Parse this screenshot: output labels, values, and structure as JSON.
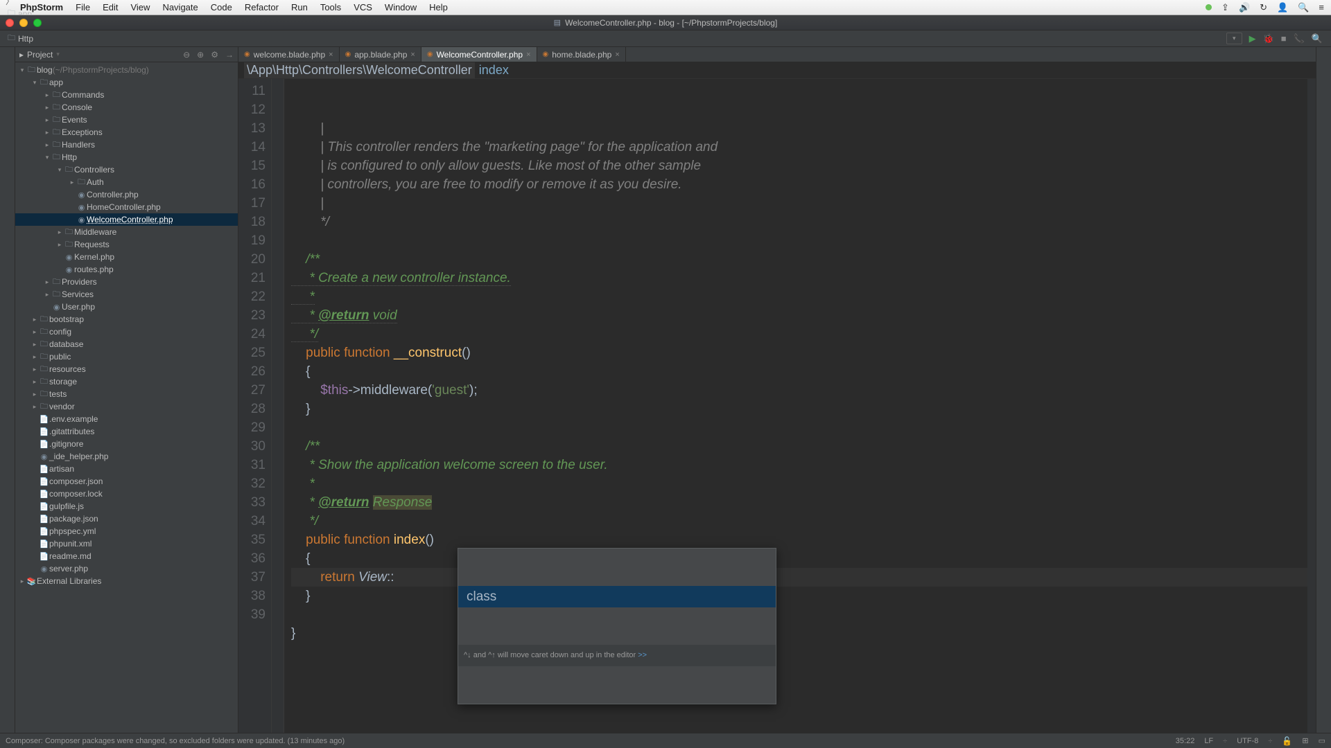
{
  "mac_menu": {
    "apple": "",
    "items": [
      "PhpStorm",
      "File",
      "Edit",
      "View",
      "Navigate",
      "Code",
      "Refactor",
      "Run",
      "Tools",
      "VCS",
      "Window",
      "Help"
    ]
  },
  "titlebar": {
    "title": "WelcomeController.php - blog - [~/PhpstormProjects/blog]"
  },
  "breadcrumbs": [
    "blog",
    "app",
    "Http",
    "Controllers",
    "WelcomeController.php"
  ],
  "tool_header": {
    "label": "Project"
  },
  "tree": [
    {
      "d": 0,
      "a": "v",
      "t": "blog",
      "suffix": " (~/PhpstormProjects/blog)",
      "icon": "dir"
    },
    {
      "d": 1,
      "a": "v",
      "t": "app",
      "icon": "dir"
    },
    {
      "d": 2,
      "a": ">",
      "t": "Commands",
      "icon": "dir"
    },
    {
      "d": 2,
      "a": ">",
      "t": "Console",
      "icon": "dir"
    },
    {
      "d": 2,
      "a": ">",
      "t": "Events",
      "icon": "dir"
    },
    {
      "d": 2,
      "a": ">",
      "t": "Exceptions",
      "icon": "dir"
    },
    {
      "d": 2,
      "a": ">",
      "t": "Handlers",
      "icon": "dir"
    },
    {
      "d": 2,
      "a": "v",
      "t": "Http",
      "icon": "dir"
    },
    {
      "d": 3,
      "a": "v",
      "t": "Controllers",
      "icon": "dir"
    },
    {
      "d": 4,
      "a": ">",
      "t": "Auth",
      "icon": "dir"
    },
    {
      "d": 4,
      "a": "",
      "t": "Controller.php",
      "icon": "php"
    },
    {
      "d": 4,
      "a": "",
      "t": "HomeController.php",
      "icon": "php"
    },
    {
      "d": 4,
      "a": "",
      "t": "WelcomeController.php",
      "icon": "php",
      "selected": true
    },
    {
      "d": 3,
      "a": ">",
      "t": "Middleware",
      "icon": "dir"
    },
    {
      "d": 3,
      "a": ">",
      "t": "Requests",
      "icon": "dir"
    },
    {
      "d": 3,
      "a": "",
      "t": "Kernel.php",
      "icon": "php"
    },
    {
      "d": 3,
      "a": "",
      "t": "routes.php",
      "icon": "php"
    },
    {
      "d": 2,
      "a": ">",
      "t": "Providers",
      "icon": "dir"
    },
    {
      "d": 2,
      "a": ">",
      "t": "Services",
      "icon": "dir"
    },
    {
      "d": 2,
      "a": "",
      "t": "User.php",
      "icon": "php"
    },
    {
      "d": 1,
      "a": ">",
      "t": "bootstrap",
      "icon": "dir"
    },
    {
      "d": 1,
      "a": ">",
      "t": "config",
      "icon": "dir"
    },
    {
      "d": 1,
      "a": ">",
      "t": "database",
      "icon": "dir"
    },
    {
      "d": 1,
      "a": ">",
      "t": "public",
      "icon": "dir"
    },
    {
      "d": 1,
      "a": ">",
      "t": "resources",
      "icon": "dir"
    },
    {
      "d": 1,
      "a": ">",
      "t": "storage",
      "icon": "dir"
    },
    {
      "d": 1,
      "a": ">",
      "t": "tests",
      "icon": "dir"
    },
    {
      "d": 1,
      "a": ">",
      "t": "vendor",
      "icon": "dir"
    },
    {
      "d": 1,
      "a": "",
      "t": ".env.example",
      "icon": "file"
    },
    {
      "d": 1,
      "a": "",
      "t": ".gitattributes",
      "icon": "file"
    },
    {
      "d": 1,
      "a": "",
      "t": ".gitignore",
      "icon": "file"
    },
    {
      "d": 1,
      "a": "",
      "t": "_ide_helper.php",
      "icon": "php"
    },
    {
      "d": 1,
      "a": "",
      "t": "artisan",
      "icon": "file"
    },
    {
      "d": 1,
      "a": "",
      "t": "composer.json",
      "icon": "file"
    },
    {
      "d": 1,
      "a": "",
      "t": "composer.lock",
      "icon": "file"
    },
    {
      "d": 1,
      "a": "",
      "t": "gulpfile.js",
      "icon": "file"
    },
    {
      "d": 1,
      "a": "",
      "t": "package.json",
      "icon": "file"
    },
    {
      "d": 1,
      "a": "",
      "t": "phpspec.yml",
      "icon": "file"
    },
    {
      "d": 1,
      "a": "",
      "t": "phpunit.xml",
      "icon": "file"
    },
    {
      "d": 1,
      "a": "",
      "t": "readme.md",
      "icon": "file"
    },
    {
      "d": 1,
      "a": "",
      "t": "server.php",
      "icon": "php"
    },
    {
      "d": 0,
      "a": ">",
      "t": "External Libraries",
      "icon": "lib"
    }
  ],
  "tabs": [
    {
      "label": "welcome.blade.php",
      "active": false
    },
    {
      "label": "app.blade.php",
      "active": false
    },
    {
      "label": "WelcomeController.php",
      "active": true
    },
    {
      "label": "home.blade.php",
      "active": false
    }
  ],
  "crumb_bar": {
    "namespace": "\\App\\Http\\Controllers\\WelcomeController",
    "method": "index"
  },
  "code_lines": [
    {
      "n": 11,
      "html": "        <span class='c-comment'>|</span>"
    },
    {
      "n": 12,
      "html": "        <span class='c-comment'>| This controller renders the \"marketing page\" for the application and</span>"
    },
    {
      "n": 13,
      "html": "        <span class='c-comment'>| is configured to only allow guests. Like most of the other sample</span>"
    },
    {
      "n": 14,
      "html": "        <span class='c-comment'>| controllers, you are free to modify or remove it as you desire.</span>"
    },
    {
      "n": 15,
      "html": "        <span class='c-comment'>|</span>"
    },
    {
      "n": 16,
      "html": "        <span class='c-comment'>*/</span>"
    },
    {
      "n": 17,
      "html": ""
    },
    {
      "n": 18,
      "html": "    <span class='c-doc'>/**</span>"
    },
    {
      "n": 19,
      "html": "<span class='dotted-underline'>     <span class='c-doc'>* Create a new controller instance.</span></span>"
    },
    {
      "n": 20,
      "html": "<span class='dotted-underline'>     <span class='c-doc'>*</span></span>"
    },
    {
      "n": 21,
      "html": "<span class='dotted-underline'>     <span class='c-doc'>* <span class='c-doc-tag'>@return</span> void</span></span>"
    },
    {
      "n": 22,
      "html": "<span class='dotted-underline'>     <span class='c-doc'>*/</span></span>"
    },
    {
      "n": 23,
      "html": "    <span class='c-keyword'>public</span> <span class='c-keyword'>function</span> <span class='c-func'>__construct</span>()"
    },
    {
      "n": 24,
      "html": "    {"
    },
    {
      "n": 25,
      "html": "        <span class='c-var'>$this</span>-&gt;middleware(<span class='c-string'>'guest'</span>);"
    },
    {
      "n": 26,
      "html": "    }"
    },
    {
      "n": 27,
      "html": ""
    },
    {
      "n": 28,
      "html": "    <span class='c-doc'>/**</span>"
    },
    {
      "n": 29,
      "html": "     <span class='c-doc'>* Show the application welcome screen to the user.</span>"
    },
    {
      "n": 30,
      "html": "     <span class='c-doc'>*</span>"
    },
    {
      "n": 31,
      "html": "     <span class='c-doc'>* <span class='c-doc-tag'>@return</span> <span class='c-doc-type'>Response</span></span>"
    },
    {
      "n": 32,
      "html": "     <span class='c-doc'>*/</span>"
    },
    {
      "n": 33,
      "html": "    <span class='c-keyword'>public</span> <span class='c-keyword'>function</span> <span class='c-func'>index</span>()"
    },
    {
      "n": 34,
      "html": "    {"
    },
    {
      "n": 35,
      "html": "        <span class='c-keyword'>return</span> <span class='c-ident'>View</span>::",
      "current": true
    },
    {
      "n": 36,
      "html": "    }"
    },
    {
      "n": 37,
      "html": ""
    },
    {
      "n": 38,
      "html": "}"
    },
    {
      "n": 39,
      "html": ""
    }
  ],
  "autocomplete": {
    "item": "class",
    "hint_prefix": "^↓ and ^↑ will move caret down and up in the editor ",
    "hint_link": ">>"
  },
  "status": {
    "message": "Composer: Composer packages were changed, so excluded folders were updated. (13 minutes ago)",
    "pos": "35:22",
    "linesep": "LF",
    "charset": "UTF-8",
    "insert": "⊕"
  }
}
